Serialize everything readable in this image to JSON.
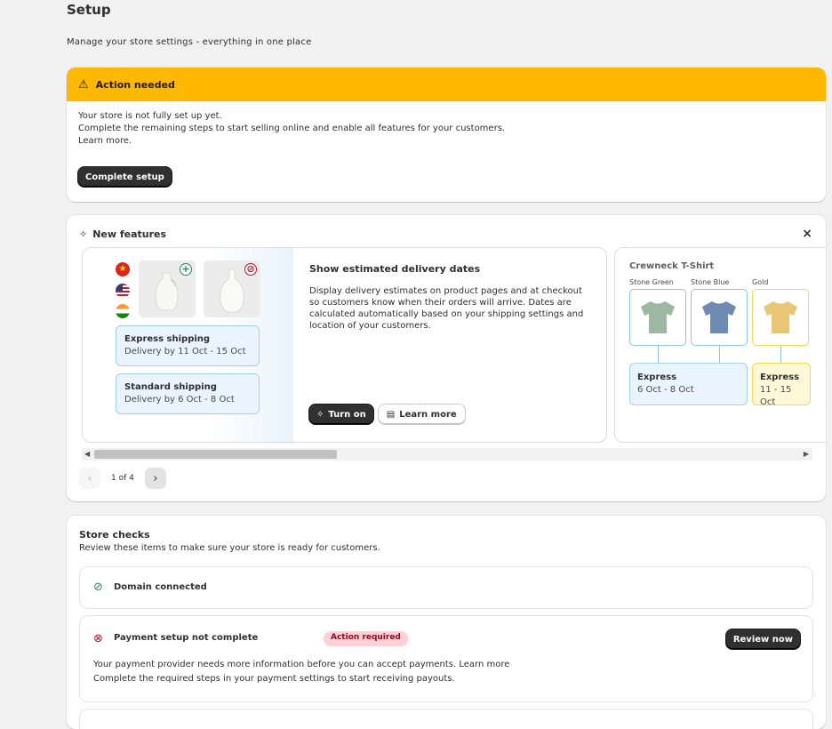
{
  "page": {
    "title": "Setup",
    "subtitle": "Manage your store settings - everything in one place"
  },
  "banner": {
    "title": "Action needed",
    "body_line1": "Your store is not fully set up yet.",
    "body_line2": "Complete the remaining steps to start selling online and enable all features for your customers.",
    "body_line3": "Learn more.",
    "button_label": "Complete setup"
  },
  "feature": {
    "header": "New features",
    "close_label": "×",
    "slide1": {
      "flags": [
        "flag-vn",
        "flag-us",
        "flag-in"
      ],
      "shipping": [
        {
          "title": "Express shipping",
          "sub": "Delivery by 11 Oct - 15 Oct"
        },
        {
          "title": "Standard shipping",
          "sub": "Delivery by 6 Oct - 8 Oct"
        }
      ],
      "copy_title": "Show estimated delivery dates",
      "copy_body": "Display delivery estimates on product pages and at checkout so customers know when their orders will arrive. Dates are calculated automatically based on your shipping settings and location of your customers.",
      "primary_button": "Turn on",
      "secondary_button": "Learn more"
    },
    "slide2": {
      "title": "Crewneck T-Shirt",
      "swatches": [
        "Stone Green",
        "Stone Blue",
        "Gold"
      ],
      "colors": [
        "#9db8a1",
        "#6e8bb3",
        "#e8c675"
      ],
      "shipping": [
        {
          "title": "Express",
          "sub": "6 Oct - 8 Oct"
        },
        {
          "title": "Express",
          "sub": "11 - 15 Oct"
        }
      ]
    },
    "pager": {
      "prev": "‹",
      "text": "1 of 4",
      "next": "›"
    }
  },
  "checks": {
    "title": "Store checks",
    "subtitle": "Review these items to make sure your store is ready for customers.",
    "items": [
      {
        "label": "Domain connected",
        "status": "ok"
      },
      {
        "label": "Payment setup not complete",
        "badge": "Action required",
        "button": "Review now",
        "desc": "Your payment provider needs more information before you can accept payments. Learn more",
        "desc2": "Complete the required steps in your payment settings to start receiving payouts."
      }
    ]
  },
  "theme": {
    "banner_bg": "#ffb800",
    "success": "#29845a",
    "critical": "#c70a24",
    "info_bg": "#eaf4ff",
    "info_border": "#a4d0f0"
  }
}
